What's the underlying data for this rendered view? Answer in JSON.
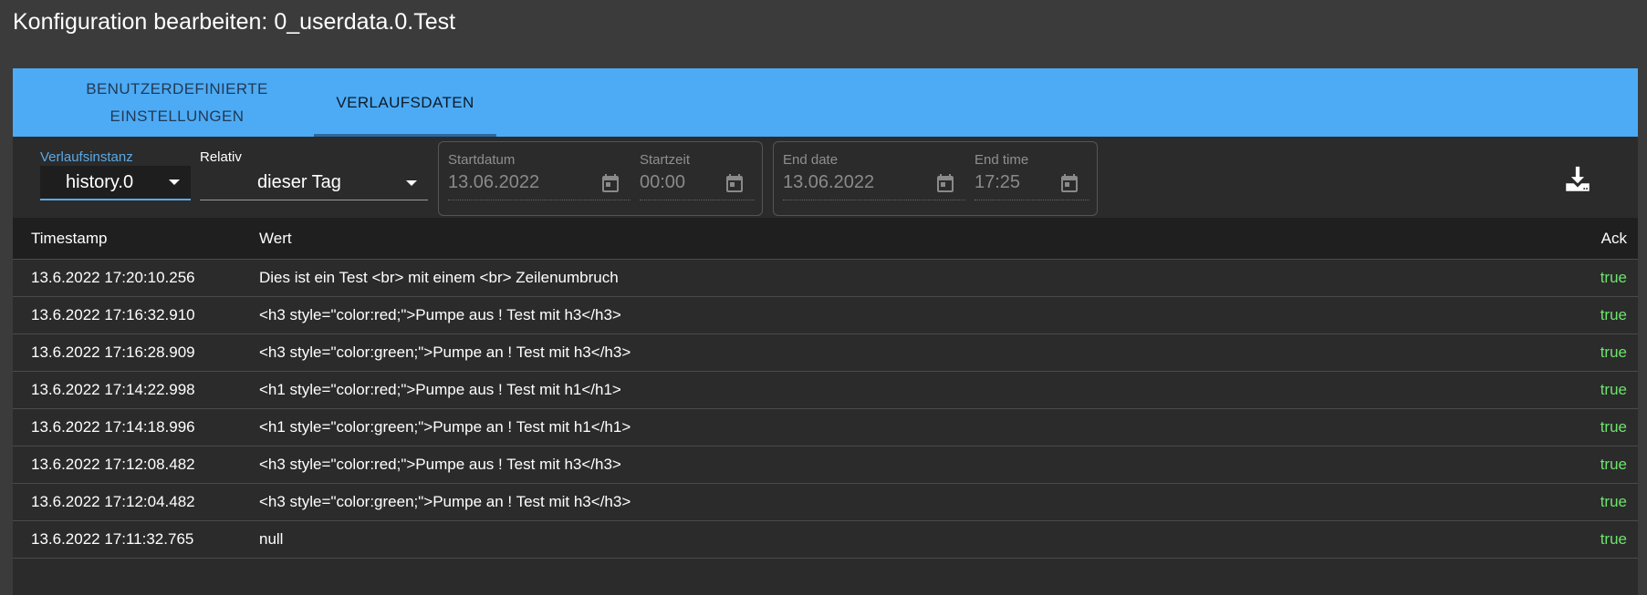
{
  "dialog": {
    "title": "Konfiguration bearbeiten: 0_userdata.0.Test"
  },
  "tabs": [
    {
      "label": "BENUTZERDEFINIERTE\nEINSTELLUNGEN",
      "active": false
    },
    {
      "label": "VERLAUFSDATEN",
      "active": true
    }
  ],
  "filters": {
    "instance_label": "Verlaufsinstanz",
    "instance_value": "history.0",
    "relative_label": "Relativ",
    "relative_value": "dieser Tag",
    "start_date_label": "Startdatum",
    "start_date_value": "13.06.2022",
    "start_time_label": "Startzeit",
    "start_time_value": "00:00",
    "end_date_label": "End date",
    "end_date_value": "13.06.2022",
    "end_time_label": "End time",
    "end_time_value": "17:25"
  },
  "colors": {
    "accent": "#4dabf5",
    "ack_true": "#6de36d",
    "label_active": "#5aa9e6"
  },
  "table": {
    "headers": {
      "timestamp": "Timestamp",
      "value": "Wert",
      "ack": "Ack"
    },
    "rows": [
      {
        "ts": "13.6.2022 17:20:10.256",
        "val": "Dies ist ein Test <br> mit einem <br> Zeilenumbruch",
        "ack": "true"
      },
      {
        "ts": "13.6.2022 17:16:32.910",
        "val": "<h3 style=\"color:red;\">Pumpe aus ! Test mit h3</h3>",
        "ack": "true"
      },
      {
        "ts": "13.6.2022 17:16:28.909",
        "val": "<h3 style=\"color:green;\">Pumpe an ! Test mit h3</h3>",
        "ack": "true"
      },
      {
        "ts": "13.6.2022 17:14:22.998",
        "val": "<h1 style=\"color:red;\">Pumpe aus ! Test mit h1</h1>",
        "ack": "true"
      },
      {
        "ts": "13.6.2022 17:14:18.996",
        "val": "<h1 style=\"color:green;\">Pumpe an ! Test mit h1</h1>",
        "ack": "true"
      },
      {
        "ts": "13.6.2022 17:12:08.482",
        "val": "<h3 style=\"color:red;\">Pumpe aus ! Test mit h3</h3>",
        "ack": "true"
      },
      {
        "ts": "13.6.2022 17:12:04.482",
        "val": "<h3 style=\"color:green;\">Pumpe an ! Test mit h3</h3>",
        "ack": "true"
      },
      {
        "ts": "13.6.2022 17:11:32.765",
        "val": "null",
        "ack": "true"
      }
    ]
  }
}
